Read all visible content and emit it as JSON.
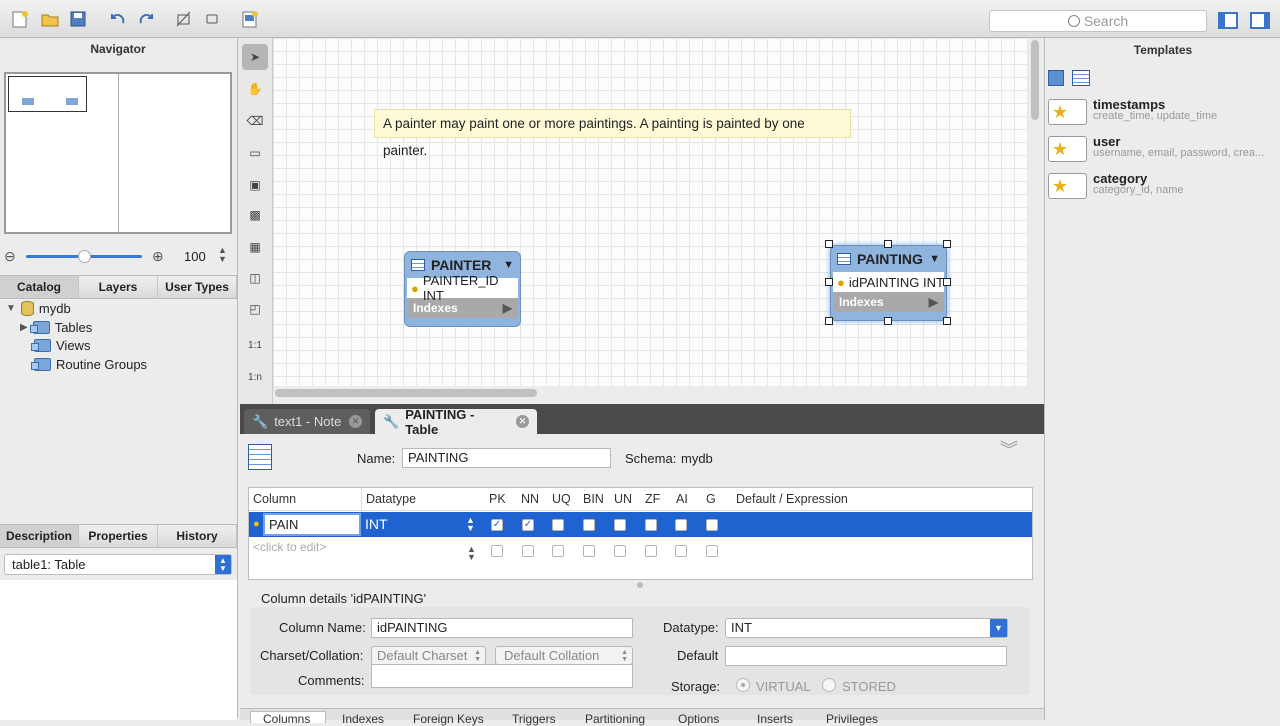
{
  "toolbar": {
    "search_placeholder": "Search"
  },
  "navigator": {
    "title": "Navigator",
    "zoom": "100"
  },
  "templates": {
    "title": "Templates",
    "items": [
      {
        "name": "timestamps",
        "desc": "create_time, update_time"
      },
      {
        "name": "user",
        "desc": "username, email, password, crea..."
      },
      {
        "name": "category",
        "desc": "category_id, name"
      }
    ]
  },
  "catalog": {
    "tabs": [
      "Catalog",
      "Layers",
      "User Types"
    ],
    "root": "mydb",
    "children": [
      "Tables",
      "Views",
      "Routine Groups"
    ]
  },
  "desc_tabs": [
    "Description",
    "Properties",
    "History"
  ],
  "object_select": "table1: Table",
  "canvas": {
    "note": "A painter may paint one or more paintings. A painting is painted by one painter.",
    "tools": {
      "rel11": "1:1",
      "rel1n": "1:n"
    },
    "entities": [
      {
        "name": "PAINTER",
        "column": "PAINTER_ID INT",
        "indexes": "Indexes"
      },
      {
        "name": "PAINTING",
        "column": "idPAINTING INT",
        "indexes": "Indexes"
      }
    ]
  },
  "editor_tabs": [
    {
      "label": "text1 - Note"
    },
    {
      "label": "PAINTING - Table"
    }
  ],
  "table_editor": {
    "name_label": "Name:",
    "name_value": "PAINTING",
    "schema_label": "Schema:",
    "schema_value": "mydb",
    "columns_header": [
      "Column",
      "Datatype",
      "PK",
      "NN",
      "UQ",
      "BIN",
      "UN",
      "ZF",
      "AI",
      "G",
      "Default / Expression"
    ],
    "row1": {
      "column": "PAIN",
      "datatype": "INT",
      "checked": [
        true,
        true,
        false,
        false,
        false,
        false,
        false,
        false
      ]
    },
    "row2": {
      "column": "<click to edit>"
    },
    "details_title": "Column details 'idPAINTING'",
    "column_name_label": "Column Name:",
    "column_name_value": "idPAINTING",
    "datatype_label": "Datatype:",
    "datatype_value": "INT",
    "charset_label": "Charset/Collation:",
    "charset_value": "Default Charset",
    "collation_value": "Default Collation",
    "default_label": "Default",
    "comments_label": "Comments:",
    "storage_label": "Storage:",
    "storage_options": [
      "VIRTUAL",
      "STORED"
    ]
  },
  "bottom_tabs": [
    "Columns",
    "Indexes",
    "Foreign Keys",
    "Triggers",
    "Partitioning",
    "Options",
    "Inserts",
    "Privileges"
  ]
}
